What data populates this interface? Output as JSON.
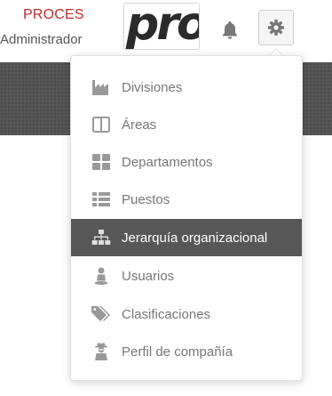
{
  "header": {
    "company": "PROCES",
    "role": "Administrador",
    "logo_text": "pro"
  },
  "icons": {
    "notifications": "bell-icon",
    "settings": "gear-icon"
  },
  "colors": {
    "company": "#c62828",
    "active_item_bg": "#575757",
    "band": "#555555"
  },
  "menu": {
    "items": [
      {
        "label": "Divisiones",
        "icon": "factory-icon"
      },
      {
        "label": "Áreas",
        "icon": "columns-icon"
      },
      {
        "label": "Departamentos",
        "icon": "grid-icon"
      },
      {
        "label": "Puestos",
        "icon": "list-icon"
      },
      {
        "label": "Jerarquía organizacional",
        "icon": "sitemap-icon",
        "active": true
      },
      {
        "label": "Usuarios",
        "icon": "user-icon"
      },
      {
        "label": "Clasificaciones",
        "icon": "tags-icon"
      },
      {
        "label": "Perfil de compañía",
        "icon": "user-secret-icon"
      }
    ]
  }
}
